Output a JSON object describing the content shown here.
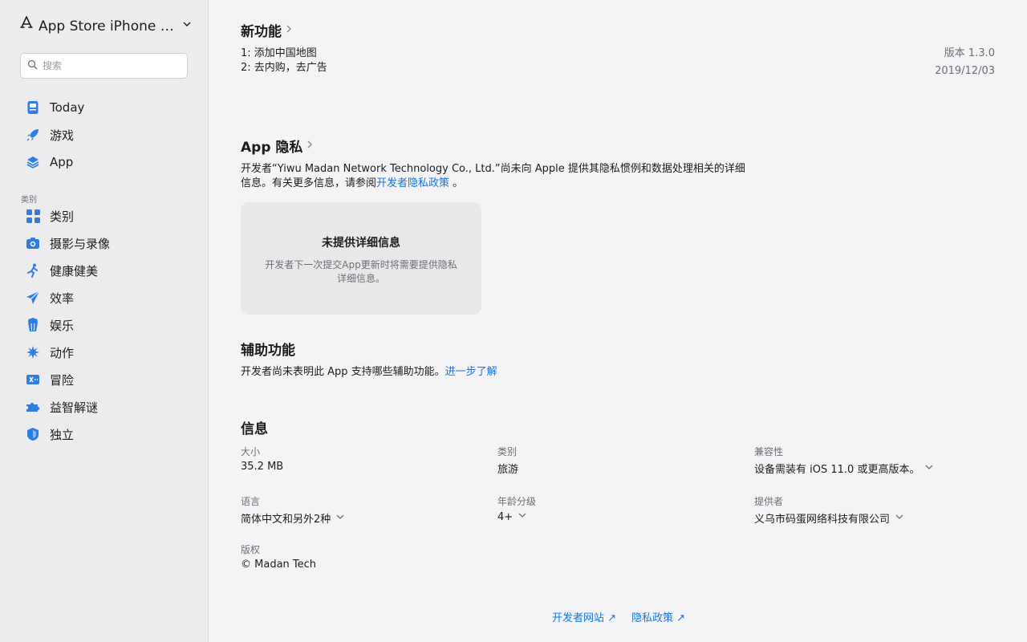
{
  "sidebar": {
    "store_title": "App Store iPhone 专...",
    "search_placeholder": "搜索",
    "items": [
      {
        "label": "Today"
      },
      {
        "label": "游戏"
      },
      {
        "label": "App"
      }
    ],
    "section_label": "类别",
    "categories": [
      {
        "label": "类别"
      },
      {
        "label": "摄影与录像"
      },
      {
        "label": "健康健美"
      },
      {
        "label": "效率"
      },
      {
        "label": "娱乐"
      },
      {
        "label": "动作"
      },
      {
        "label": "冒险"
      },
      {
        "label": "益智解谜"
      },
      {
        "label": "独立"
      }
    ]
  },
  "whats_new": {
    "title": "新功能",
    "line1": "1: 添加中国地图",
    "line2": "2: 去内购，去广告",
    "version": "版本 1.3.0",
    "date": "2019/12/03"
  },
  "privacy": {
    "title": "App 隐私",
    "text_line1": "开发者“Yiwu Madan Network Technology Co., Ltd.”尚未向 Apple 提供其隐私惯例和数据处理相关的详细",
    "text_line2_prefix": "信息。有关更多信息，请参阅",
    "policy_link": "开发者隐私政策",
    "text_line2_suffix": " 。",
    "card_title": "未提供详细信息",
    "card_desc": "开发者下一次提交App更新时将需要提供隐私详细信息。"
  },
  "accessibility": {
    "title": "辅助功能",
    "text": "开发者尚未表明此 App 支持哪些辅助功能。",
    "link": "进一步了解"
  },
  "info": {
    "title": "信息",
    "size_label": "大小",
    "size_value": "35.2 MB",
    "category_label": "类别",
    "category_value": "旅游",
    "compat_label": "兼容性",
    "compat_value": "设备需装有 iOS 11.0 或更高版本。",
    "lang_label": "语言",
    "lang_value": "简体中文和另外2种",
    "age_label": "年龄分级",
    "age_value": "4+",
    "provider_label": "提供者",
    "provider_value": "义乌市码蛋网络科技有限公司",
    "copyright_label": "版权",
    "copyright_value": "© Madan Tech"
  },
  "footer": {
    "dev_site": "开发者网站 ↗",
    "privacy_policy": "隐私政策 ↗"
  },
  "colors": {
    "accent": "#1a73d9",
    "sidebar_bg": "#ececef",
    "main_bg": "#f4f4f6"
  }
}
